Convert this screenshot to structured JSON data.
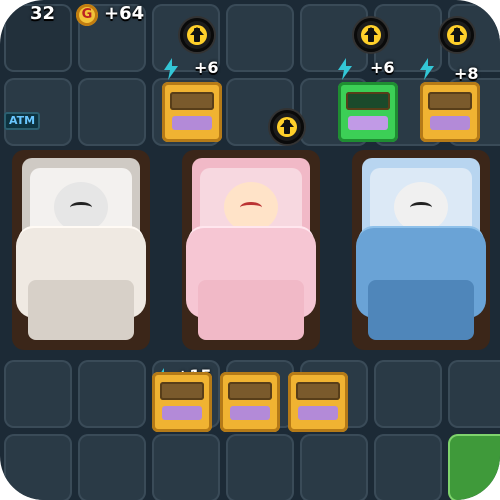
{
  "topbar": {
    "count_left": "32",
    "coin_symbol": "G",
    "coin_value": "+64"
  },
  "income_labels": {
    "row2_col2": "+6",
    "row2_col5": "+6",
    "row2_col6": "+8",
    "row6_col2": "+15"
  },
  "atm_label": "ATM",
  "beds": [
    {
      "name": "bed-left",
      "blanket_color": "#efe9e2",
      "pillow_color": "#f3f1ef",
      "frame_color": "#3b2619"
    },
    {
      "name": "bed-middle",
      "blanket_color": "#f6c6d3",
      "pillow_color": "#f7d8e0",
      "frame_color": "#3b2619"
    },
    {
      "name": "bed-right",
      "blanket_color": "#6aa3d6",
      "pillow_color": "#dce9f6",
      "frame_color": "#3b2619"
    }
  ],
  "colors": {
    "board_bg": "#1c2a36",
    "tile_bg": "#2a3a46",
    "upgrade_yellow": "#ffd02a",
    "arcade_yellow": "#f0b332",
    "arcade_green": "#3ccf56",
    "highlight_green": "#3f9a3a"
  },
  "icons": [
    "upgrade-arrow-icon",
    "lightning-bolt-icon",
    "coin-icon",
    "arcade-machine-icon",
    "bed-icon",
    "atm-icon"
  ]
}
